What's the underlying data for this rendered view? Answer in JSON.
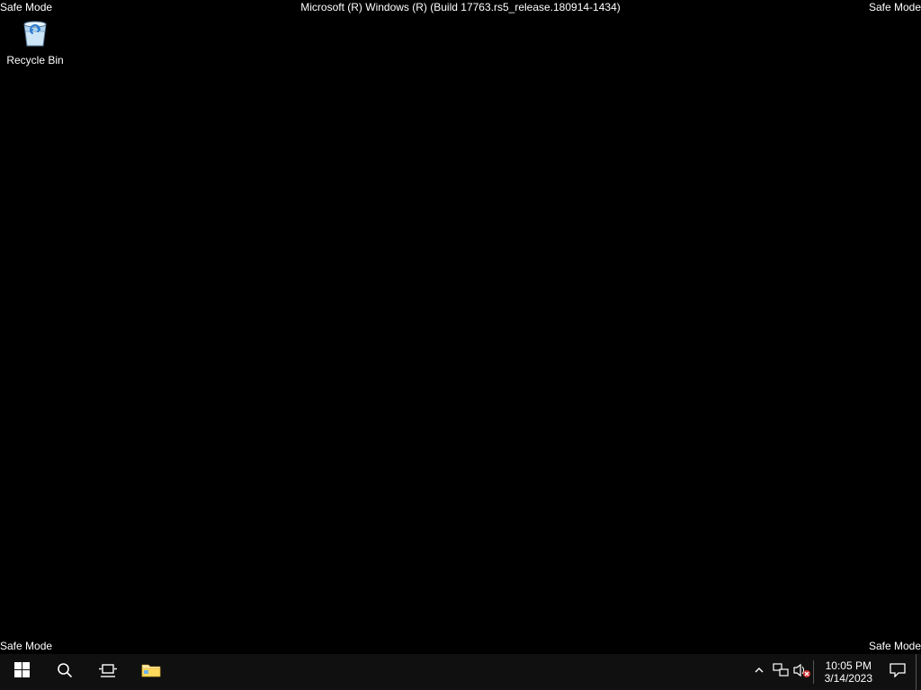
{
  "safemode": {
    "label": "Safe Mode",
    "build": "Microsoft (R) Windows (R) (Build 17763.rs5_release.180914-1434)"
  },
  "desktop": {
    "recycle_bin": "Recycle Bin"
  },
  "taskbar": {
    "time": "10:05 PM",
    "date": "3/14/2023"
  }
}
